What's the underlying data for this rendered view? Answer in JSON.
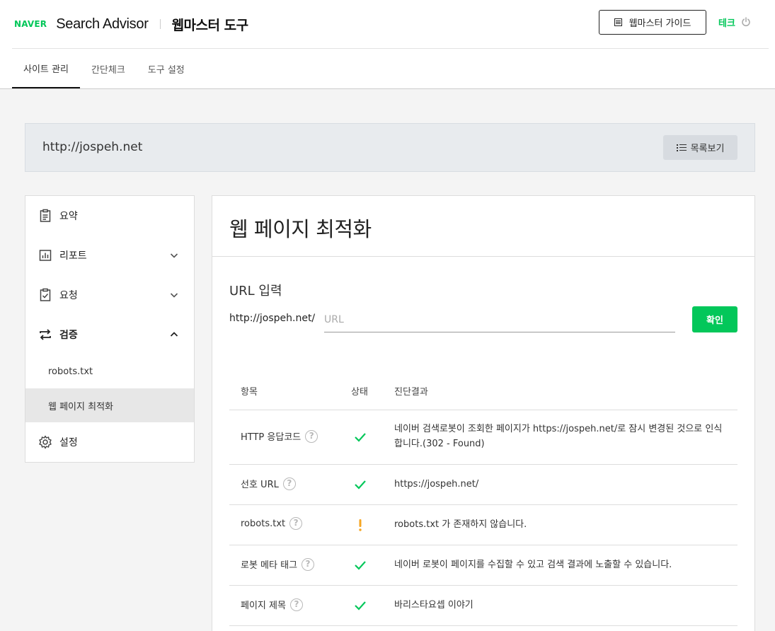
{
  "header": {
    "naver_logo": "NAVER",
    "product_name": "Search Advisor",
    "tool_title": "웹마스터 도구",
    "guide_button": "웹마스터 가이드",
    "user_name": "테크",
    "brand_color": "#03c75a"
  },
  "tabs": [
    {
      "label": "사이트 관리",
      "active": true
    },
    {
      "label": "간단체크",
      "active": false
    },
    {
      "label": "도구 설정",
      "active": false
    }
  ],
  "site": {
    "url": "http://jospeh.net",
    "list_button": "목록보기"
  },
  "sidebar": {
    "items": [
      {
        "label": "요약",
        "icon": "clipboard-icon"
      },
      {
        "label": "리포트",
        "icon": "chart-icon",
        "expanded": false
      },
      {
        "label": "요청",
        "icon": "clipboard-check-icon",
        "expanded": false
      },
      {
        "label": "검증",
        "icon": "swap-icon",
        "expanded": true
      },
      {
        "label": "설정",
        "icon": "gear-icon"
      }
    ],
    "sub_items": [
      {
        "label": "robots.txt",
        "active": false
      },
      {
        "label": "웹 페이지 최적화",
        "active": true
      }
    ]
  },
  "main": {
    "title": "웹 페이지 최적화",
    "section_title": "URL 입력",
    "url_prefix": "http://jospeh.net/",
    "url_placeholder": "URL",
    "url_value": "",
    "confirm_button": "확인",
    "table": {
      "headers": [
        "항목",
        "상태",
        "진단결과"
      ],
      "rows": [
        {
          "item": "HTTP 응답코드",
          "status": "ok",
          "result": "네이버 검색로봇이 조회한 페이지가 https://jospeh.net/로 잠시 변경된 것으로 인식합니다.(302 - Found)"
        },
        {
          "item": "선호 URL",
          "status": "ok",
          "result": "https://jospeh.net/"
        },
        {
          "item": "robots.txt",
          "status": "warning",
          "result": "robots.txt 가 존재하지 않습니다."
        },
        {
          "item": "로봇 메타 태그",
          "status": "ok",
          "result": "네이버 로봇이 페이지를 수집할 수 있고 검색 결과에 노출할 수 있습니다."
        },
        {
          "item": "페이지 제목",
          "status": "ok",
          "result": "바리스타요셉 이야기"
        }
      ]
    },
    "status_colors": {
      "ok": "#03c75a",
      "warning": "#f5a623"
    }
  }
}
